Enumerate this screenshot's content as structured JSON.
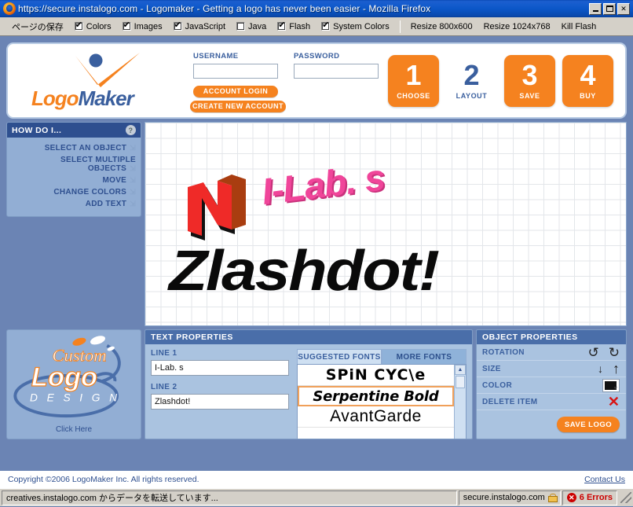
{
  "browser": {
    "title": "https://secure.instalogo.com - Logomaker - Getting a logo has never been easier - Mozilla Firefox",
    "minimize_label": "Minimize",
    "maximize_label": "Maximize",
    "close_label": "✕"
  },
  "devtoolbar": {
    "save_page": "ページの保存",
    "toggles": [
      {
        "label": "Colors",
        "checked": true
      },
      {
        "label": "Images",
        "checked": true
      },
      {
        "label": "JavaScript",
        "checked": true
      },
      {
        "label": "Java",
        "checked": false
      },
      {
        "label": "Flash",
        "checked": true
      },
      {
        "label": "System Colors",
        "checked": true
      }
    ],
    "actions": [
      "Resize 800x600",
      "Resize 1024x768",
      "Kill Flash"
    ]
  },
  "header": {
    "brand_logo": "LogoMaker",
    "brand_part1": "Logo",
    "brand_part2": "Maker",
    "username_label": "USERNAME",
    "password_label": "PASSWORD",
    "username_value": "",
    "password_value": "",
    "account_login": "ACCOUNT LOGIN",
    "create_account": "CREATE NEW ACCOUNT",
    "steps": [
      {
        "num": "1",
        "caption": "CHOOSE",
        "active": true
      },
      {
        "num": "2",
        "caption": "LAYOUT",
        "active": false
      },
      {
        "num": "3",
        "caption": "SAVE",
        "active": true
      },
      {
        "num": "4",
        "caption": "BUY",
        "active": true
      }
    ]
  },
  "howdoi": {
    "title": "HOW DO I...",
    "help_icon": "?",
    "items": [
      "SELECT AN OBJECT",
      "SELECT MULTIPLE OBJECTS",
      "MOVE",
      "CHANGE COLORS",
      "ADD TEXT"
    ]
  },
  "canvas": {
    "line1": "I-Lab. s",
    "line2": "Zlashdot!",
    "line1_color": "#f0459a",
    "line2_color": "#0a0a0a",
    "mark_colors": [
      "#ef2a28",
      "#a93d10",
      "#111111"
    ]
  },
  "promo": {
    "word1": "Custom",
    "word2": "Logo",
    "word3": "D E S I G N",
    "click_here": "Click Here"
  },
  "text_properties": {
    "title": "TEXT PROPERTIES",
    "line1_label": "LINE 1",
    "line2_label": "LINE 2",
    "line1_value": "I-Lab. s",
    "line2_value": "Zlashdot!",
    "line1_placeholder": "",
    "line2_placeholder": "",
    "tab_suggested": "SUGGESTED FONTS",
    "tab_more": "MORE FONTS",
    "active_tab": "SUGGESTED FONTS",
    "fonts": [
      {
        "name": "SPiN CYC\\e",
        "selected": false
      },
      {
        "name": "Serpentine Bold",
        "selected": true
      },
      {
        "name": "AvantGarde",
        "selected": false
      },
      {
        "name": "",
        "selected": false
      }
    ]
  },
  "object_properties": {
    "title": "OBJECT PROPERTIES",
    "rows": [
      {
        "label": "ROTATION",
        "icons": [
          "rotate-left-icon",
          "rotate-right-icon"
        ]
      },
      {
        "label": "SIZE",
        "icons": [
          "arrow-down-icon",
          "arrow-up-icon"
        ]
      },
      {
        "label": "COLOR",
        "icons": [
          "color-swatch-icon"
        ]
      },
      {
        "label": "DELETE ITEM",
        "icons": [
          "delete-x-icon"
        ]
      }
    ],
    "rotate_left": "↺",
    "rotate_right": "↻",
    "size_down": "↓",
    "size_up": "↑",
    "delete_x": "✕",
    "save_logo": "SAVE LOGO",
    "color_value": "#111111"
  },
  "footer": {
    "copyright": "Copyright ©2006 LogoMaker Inc. All rights reserved.",
    "contact": "Contact Us"
  },
  "statusbar": {
    "message": "creatives.instalogo.com からデータを転送しています...",
    "site": "secure.instalogo.com",
    "errors": "6 Errors",
    "error_badge": "✕"
  },
  "colors": {
    "page_bg": "#6b84b4",
    "orange": "#f5821f",
    "deep_blue": "#2e4f8f",
    "panel_blue": "#aac3e0",
    "titlebar_blue": "#0b57c8"
  }
}
